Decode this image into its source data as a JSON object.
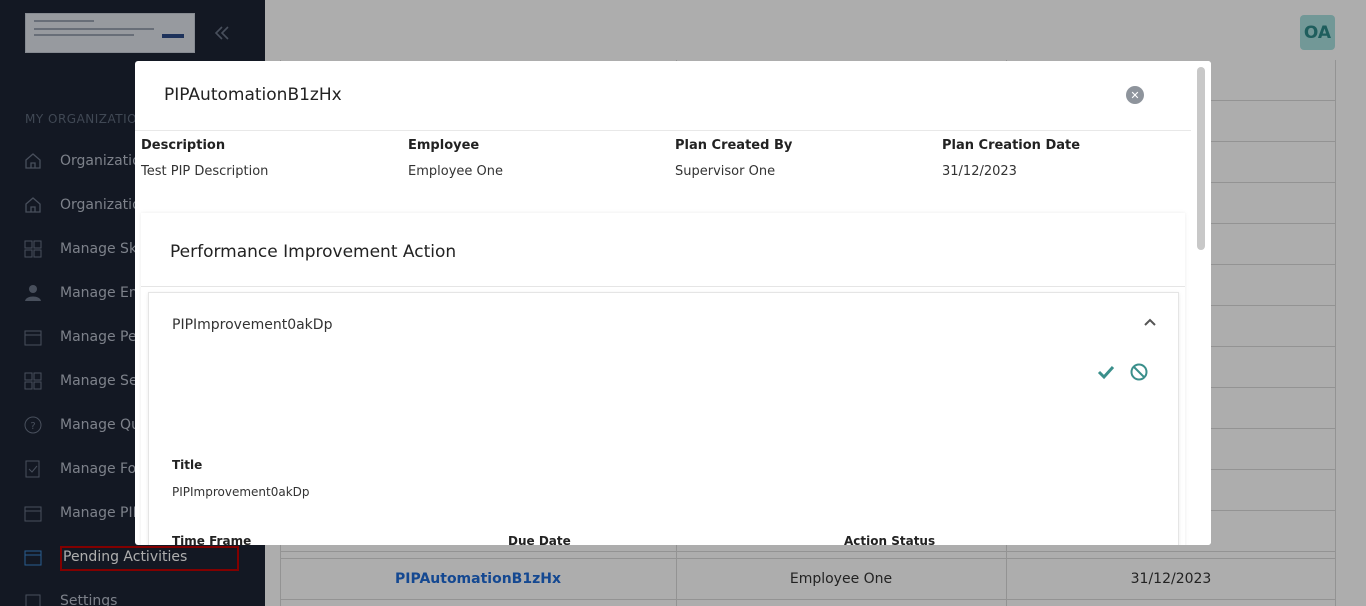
{
  "sidebar": {
    "section_title": "MY ORGANIZATION",
    "items": [
      {
        "label": "Organization",
        "icon": "home-icon"
      },
      {
        "label": "Organization",
        "icon": "home-icon"
      },
      {
        "label": "Manage Skills",
        "icon": "grid-icon"
      },
      {
        "label": "Manage Employees",
        "icon": "user-icon"
      },
      {
        "label": "Manage Periods",
        "icon": "calendar-icon"
      },
      {
        "label": "Manage Sections",
        "icon": "grid-icon"
      },
      {
        "label": "Manage Questions",
        "icon": "question-icon"
      },
      {
        "label": "Manage Forms",
        "icon": "form-icon"
      },
      {
        "label": "Manage PIP",
        "icon": "calendar-icon"
      },
      {
        "label": "Pending Activities",
        "icon": "calendar-icon"
      },
      {
        "label": "Settings",
        "icon": "gear-icon"
      }
    ]
  },
  "header": {
    "avatar_initials": "OA"
  },
  "background_table": {
    "last_row": {
      "plan": "PIPAutomationB1zHx",
      "employee": "Employee One",
      "date": "31/12/2023"
    }
  },
  "modal": {
    "title": "PIPAutomationB1zHx",
    "info": {
      "description_label": "Description",
      "description_value": "Test PIP Description",
      "employee_label": "Employee",
      "employee_value": "Employee One",
      "created_by_label": "Plan Created By",
      "created_by_value": "Supervisor One",
      "creation_date_label": "Plan Creation Date",
      "creation_date_value": "31/12/2023"
    },
    "section_title": "Performance Improvement Action",
    "improvement": {
      "name": "PIPImprovement0akDp",
      "title_label": "Title",
      "title_value": "PIPImprovement0akDp",
      "time_frame_label": "Time Frame",
      "due_date_label": "Due Date",
      "action_status_label": "Action Status"
    }
  },
  "colors": {
    "sidebar_bg": "#1c2434",
    "accent_teal": "#2e8b8a",
    "link_blue": "#1e6bd6",
    "highlight_red": "#c00000"
  }
}
